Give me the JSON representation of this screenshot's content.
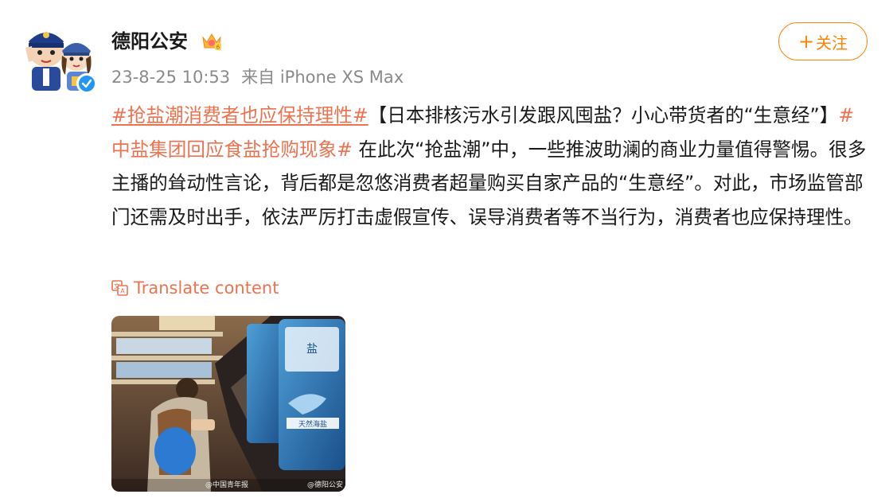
{
  "header": {
    "username": "德阳公安",
    "vip_badge_icon": "crown-vip-icon",
    "timestamp": "23-8-25 10:53",
    "source": "来自 iPhone XS Max",
    "follow_label": "关注",
    "follow_plus": "+"
  },
  "post": {
    "hashtag1": "#抢盐潮消费者也应保持理性#",
    "segment1": "【日本排核污水引发跟风囤盐？小心带货者的“生意经”】",
    "hashtag2": "#中盐集团回应食盐抢购现象#",
    "segment2": " 在此次“抢盐潮”中，一些推波助澜的商业力量值得警惕。很多主播的耸动性言论，背后都是忽悠消费者超量购买自家产品的“生意经”。对此，市场监管部门还需及时出手，依法严厉打击虚假宣传、误导消费者等不当行为，消费者也应保持理性。"
  },
  "translate": {
    "label": "Translate content"
  },
  "image": {
    "watermark_left": "@中国青年报",
    "watermark_right": "@德阳公安"
  },
  "colors": {
    "accent": "#eb7350",
    "follow": "#ff8200",
    "meta": "#8a8a8a",
    "verified": "#2196f3"
  }
}
